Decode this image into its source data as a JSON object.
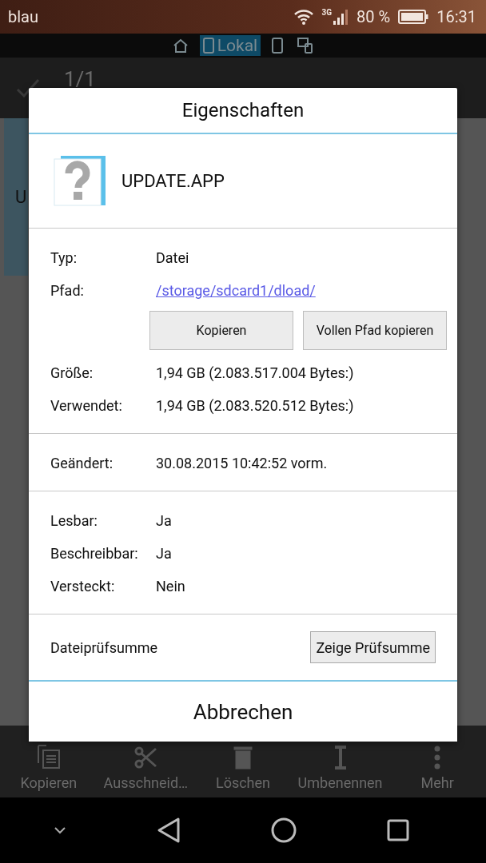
{
  "status_bar": {
    "carrier": "blau",
    "network": "3G",
    "battery": "80 %",
    "time": "16:31"
  },
  "location_tabs": [
    {
      "kind": "home",
      "selected": false
    },
    {
      "kind": "local",
      "label": "Lokal",
      "selected": true
    },
    {
      "kind": "phone",
      "selected": false
    },
    {
      "kind": "devices",
      "selected": false
    }
  ],
  "toolbar": {
    "counter": "1/1"
  },
  "file_tile": {
    "label": "U",
    "selected": true
  },
  "dialog": {
    "title": "Eigenschaften",
    "file_name": "UPDATE.APP",
    "sections": [
      {
        "rows": [
          {
            "kind": "text",
            "label": "Typ:",
            "value": "Datei"
          },
          {
            "kind": "link",
            "label": "Pfad:",
            "value": "/storage/sdcard1/dload/"
          },
          {
            "kind": "buttons",
            "buttons": [
              "Kopieren",
              "Vollen Pfad kopieren"
            ]
          },
          {
            "kind": "text",
            "label": "Größe:",
            "value": "1,94 GB (2.083.517.004 Bytes:)"
          },
          {
            "kind": "text",
            "label": "Verwendet:",
            "value": "1,94 GB (2.083.520.512 Bytes:)"
          }
        ]
      },
      {
        "rows": [
          {
            "kind": "text",
            "label": "Geändert:",
            "value": "30.08.2015 10:42:52 vorm."
          }
        ]
      },
      {
        "rows": [
          {
            "kind": "text",
            "label": "Lesbar:",
            "value": "Ja"
          },
          {
            "kind": "text",
            "label": "Beschreibbar:",
            "value": "Ja"
          },
          {
            "kind": "text",
            "label": "Versteckt:",
            "value": "Nein"
          }
        ]
      }
    ],
    "checksum": {
      "label": "Dateiprüfsumme",
      "button": "Zeige Prüfsumme"
    },
    "cancel": "Abbrechen"
  },
  "bottom_actions": [
    {
      "kind": "copy",
      "label": "Kopieren"
    },
    {
      "kind": "cut",
      "label": "Ausschneid…"
    },
    {
      "kind": "delete",
      "label": "Löschen"
    },
    {
      "kind": "rename",
      "label": "Umbenennen"
    },
    {
      "kind": "more",
      "label": "Mehr"
    }
  ]
}
